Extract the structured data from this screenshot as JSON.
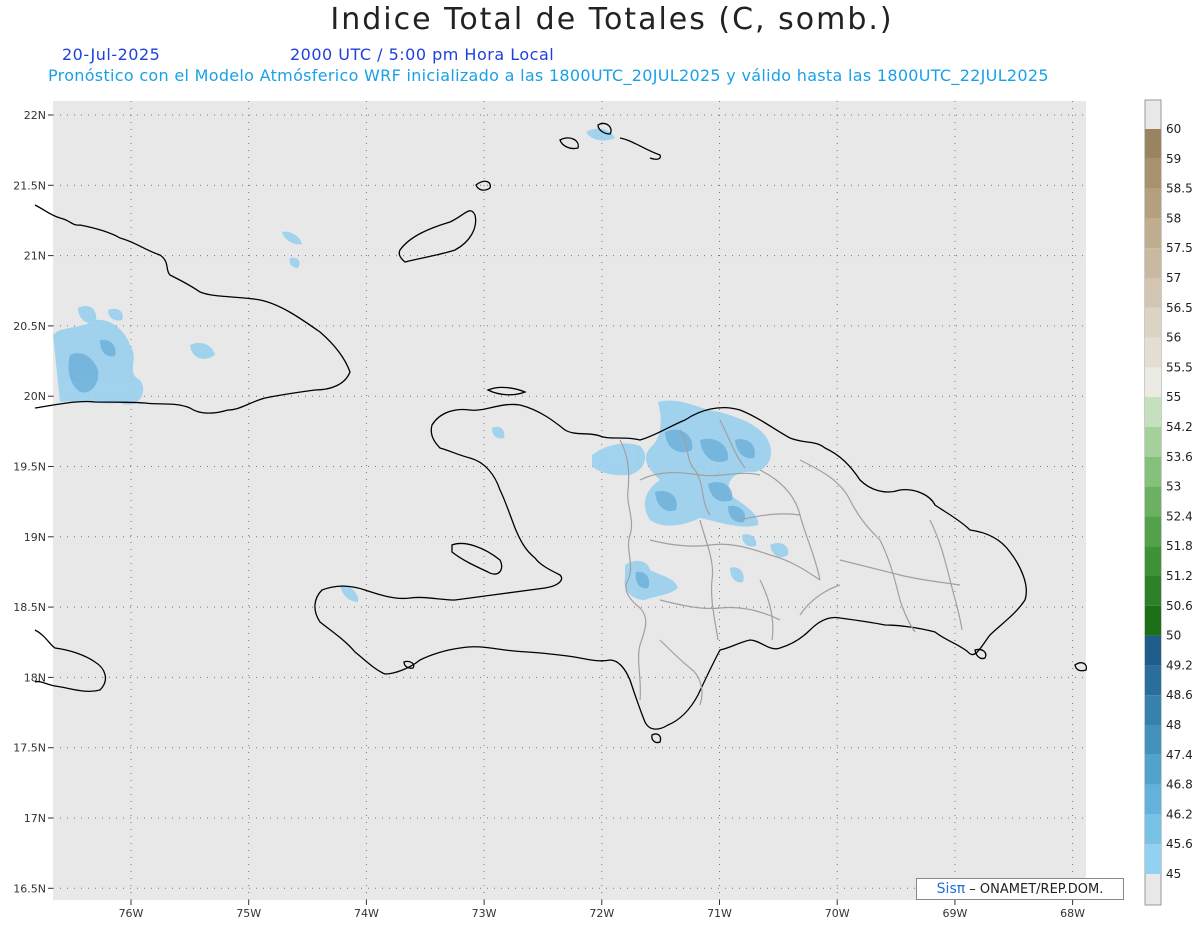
{
  "header": {
    "title": "Indice Total de Totales (C, somb.)",
    "date": "20-Jul-2025",
    "time": "2000 UTC / 5:00 pm Hora Local",
    "subtitle": "Pronóstico con el Modelo Atmósferico WRF inicializado a las 1800UTC_20JUL2025 y válido hasta las  1800UTC_22JUL2025"
  },
  "map": {
    "lat_ticks": [
      "22N",
      "21.5N",
      "21N",
      "20.5N",
      "20N",
      "19.5N",
      "19N",
      "18.5N",
      "18N",
      "17.5N",
      "17N",
      "16.5N"
    ],
    "lon_ticks": [
      "76W",
      "75W",
      "74W",
      "73W",
      "72W",
      "71W",
      "70W",
      "69W",
      "68W"
    ],
    "background_color": "#e8e8e8",
    "coastline_color": "#000000",
    "province_color": "#a0a0a0"
  },
  "colorbar": {
    "labels": [
      "60",
      "59",
      "58.5",
      "58",
      "57.5",
      "57",
      "56.5",
      "56",
      "55.5",
      "55",
      "54.2",
      "53.6",
      "53",
      "52.4",
      "51.8",
      "51.2",
      "50.6",
      "50",
      "49.2",
      "48.6",
      "48",
      "47.4",
      "46.8",
      "46.2",
      "45.6",
      "45"
    ],
    "colors": [
      "#9a8360",
      "#a8916e",
      "#b4a07f",
      "#c0ad90",
      "#c9b9a0",
      "#d2c6b2",
      "#dbd3c4",
      "#e4ded2",
      "#ecebe3",
      "#c4e0bc",
      "#a4d09a",
      "#86c17c",
      "#6cb062",
      "#54a14c",
      "#3f9138",
      "#2c8027",
      "#1d7018",
      "#1f5e8a",
      "#2a6f9c",
      "#3681ad",
      "#4392be",
      "#51a2cd",
      "#62b2db",
      "#78c2e6",
      "#92d1ef",
      "#e8e8e8"
    ],
    "min_label": "45",
    "max_label": "60"
  },
  "credit": {
    "logo": "Sisπ",
    "text": " – ONAMET/REP.DOM."
  }
}
